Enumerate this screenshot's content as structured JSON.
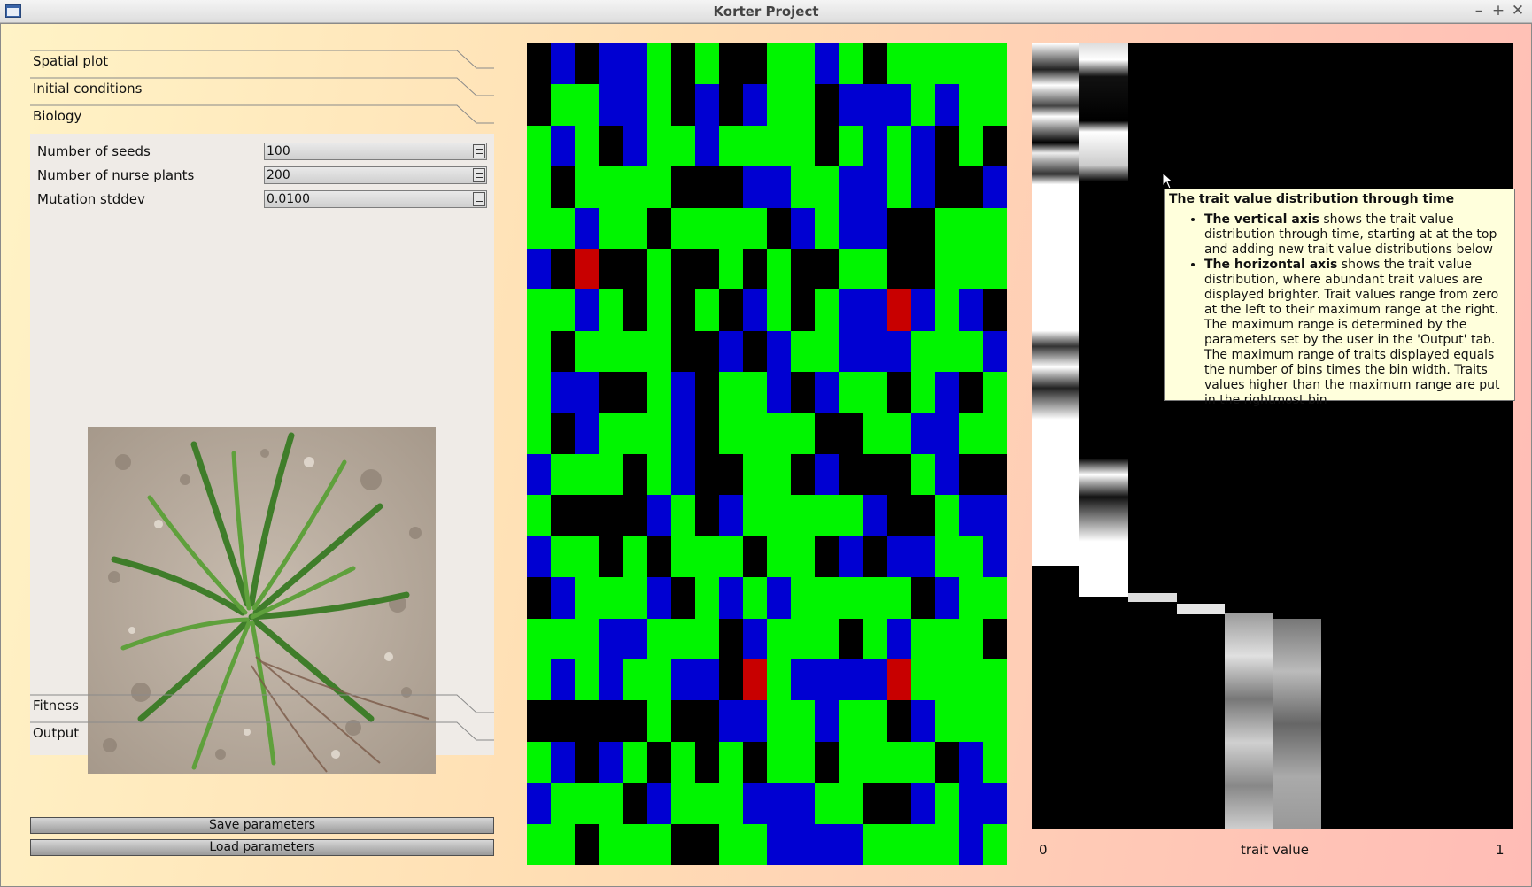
{
  "window": {
    "title": "Korter Project",
    "controls": {
      "minimize": "–",
      "maximize": "+",
      "close": "✕"
    }
  },
  "sections": {
    "spatial_plot": "Spatial plot",
    "initial_conditions": "Initial conditions",
    "biology": "Biology",
    "fitness": "Fitness",
    "output": "Output"
  },
  "biology": {
    "params": [
      {
        "label": "Number of seeds",
        "value": "100"
      },
      {
        "label": "Number of nurse plants",
        "value": "200"
      },
      {
        "label": "Mutation stddev",
        "value": "0.0100"
      }
    ]
  },
  "buttons": {
    "save": "Save parameters",
    "load": "Load parameters"
  },
  "spatial_grid": {
    "colors": {
      "G": "#00f500",
      "B": "#0000d2",
      "K": "#000000",
      "R": "#c80000"
    },
    "rows": [
      "KBKBBGKGKKGGBGKGGGGG",
      "KGGBBGKBKBGGKBBBGBGG",
      "GBGKBGGBGGGGKGBGBKGK",
      "GKGGGGKKKBBGGBBGBKKB",
      "GGBGGKGGGGKBGBBKKGGG",
      "BKRKKGKKGKGKKGGKKGGG",
      "GGBGKGKGKBGKGBBRBGBK",
      "GKGGGGKKBKBGGBBBGGGB",
      "GBBKKGBKGGBKBGGKGBKG",
      "GKBGGGBKGGGGKKGGBBGG",
      "BGGGKGBKKGGKBKKKGBKK",
      "GKKKKBGKBGGGGGBKKGBB",
      "BGGKGKGGGKGGKBKBBGGB",
      "KBGGGBKGBGBGGGGGKBGG",
      "GGGBBGGGKBGGGKGBGGGK",
      "GBGBGGBBKRGBBBBRGGGG",
      "KKKKKGKKBBGGBGGKBGGG",
      "GBKBGKGKGKGGKGGGGKBG",
      "BGGGKBGGGBBBGGKKBGBB",
      "GGKGGGKKGGBBBBGGGGBG"
    ]
  },
  "trait_plot": {
    "xlabel": "trait value",
    "xmin_label": "0",
    "xmax_label": "1"
  },
  "tooltip": {
    "title": "The trait value distribution through time",
    "bullet1_bold": "The vertical axis",
    "bullet1_text": " shows the trait value distribution through time, starting at at the top and adding new trait value distributions below",
    "bullet2_bold": "The horizontal axis",
    "bullet2_text": " shows the trait value distribution, where abundant trait values are displayed brighter. Trait values range from zero at the left to their maximum range at the right. The maximum range is determined by the parameters set by the user in the 'Output' tab. The maximum range of traits displayed equals the number of bins times the bin width. Traits values higher than the maximum range are put in the rightmost bin"
  }
}
